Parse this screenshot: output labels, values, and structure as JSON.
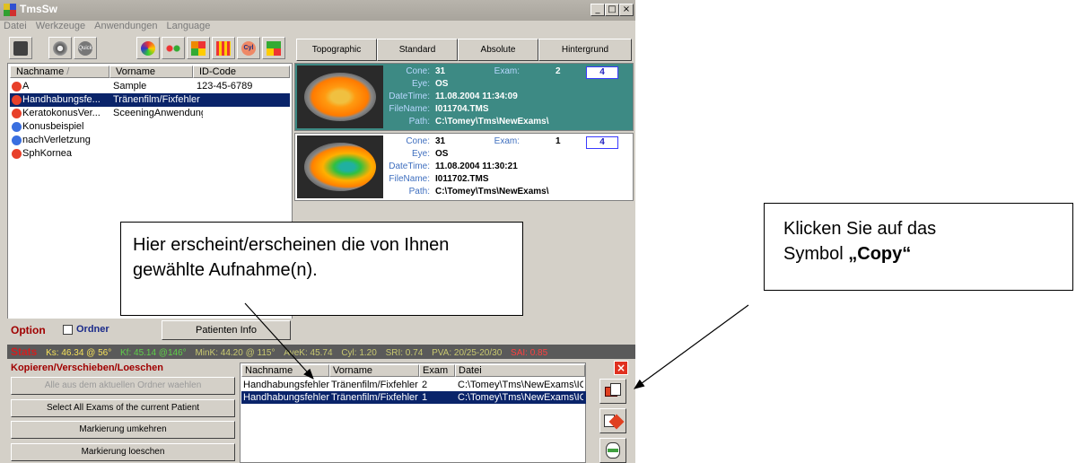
{
  "window": {
    "title": "TmsSw",
    "controls": [
      "_",
      "□",
      "×"
    ]
  },
  "menu": [
    "Datei",
    "Werkzeuge",
    "Anwendungen",
    "Language"
  ],
  "toolbar": {
    "icons": [
      "film-icon",
      "disc-icon",
      "quick-icon",
      "color-wheel-icon",
      "dots-icon",
      "grid-icon",
      "matrix-icon",
      "cyl-icon",
      "compare-icon"
    ],
    "quick_label": "Quick",
    "cyl_label": "Cyl"
  },
  "tabs": [
    "Topographic",
    "Standard",
    "Absolute",
    "Hintergrund"
  ],
  "patient_list": {
    "headers": [
      "Nachname",
      "Vorname",
      "ID-Code"
    ],
    "rows": [
      {
        "lastname": "A",
        "firstname": "Sample",
        "id": "123-45-6789",
        "icon_color": "#e8402a"
      },
      {
        "lastname": "Handhabungsfe...",
        "firstname": "Tränenfilm/Fixfehler",
        "id": "",
        "icon_color": "#e8402a",
        "selected": true
      },
      {
        "lastname": "KeratokonusVer...",
        "firstname": "SceeningAnwendung!",
        "id": "",
        "icon_color": "#e8402a"
      },
      {
        "lastname": "Konusbeispiel",
        "firstname": "",
        "id": "",
        "icon_color": "#3a6fe0"
      },
      {
        "lastname": "nachVerletzung",
        "firstname": "",
        "id": "",
        "icon_color": "#3a6fe0"
      },
      {
        "lastname": "SphKornea",
        "firstname": "",
        "id": "",
        "icon_color": "#e8402a"
      }
    ]
  },
  "exam_cards": [
    {
      "cone_label": "Cone:",
      "cone": "31",
      "exam_label": "Exam:",
      "exam": "2",
      "eye_label": "Eye:",
      "eye": "OS",
      "datetime_label": "DateTime:",
      "datetime": "11.08.2004 11:34:09",
      "filename_label": "FileName:",
      "filename": "I011704.TMS",
      "path_label": "Path:",
      "path": "C:\\Tomey\\Tms\\NewExams\\",
      "number": "4",
      "selected": true
    },
    {
      "cone_label": "Cone:",
      "cone": "31",
      "exam_label": "Exam:",
      "exam": "1",
      "eye_label": "Eye:",
      "eye": "OS",
      "datetime_label": "DateTime:",
      "datetime": "11.08.2004 11:30:21",
      "filename_label": "FileName:",
      "filename": "I011702.TMS",
      "path_label": "Path:",
      "path": "C:\\Tomey\\Tms\\NewExams\\",
      "number": "4",
      "selected": false
    }
  ],
  "option": {
    "label": "Option",
    "ordner_label": "Ordner",
    "patienten_info": "Patienten Info"
  },
  "stats": {
    "label": "Stats",
    "items": [
      {
        "text": "Ks: 46.34 @ 56°",
        "color": "#f5e05a"
      },
      {
        "text": "Kf: 45.14 @146°",
        "color": "#5fcf4a"
      },
      {
        "text": "MinK: 44.20 @ 115°",
        "color": "#c8c870"
      },
      {
        "text": "AveK: 45.74",
        "color": "#c8c870"
      },
      {
        "text": "Cyl: 1.20",
        "color": "#c8c870"
      },
      {
        "text": "SRI: 0.74",
        "color": "#c8c870"
      },
      {
        "text": "PVA: 20/25-20/30",
        "color": "#c8c870"
      },
      {
        "text": "SAI: 0.85",
        "color": "#ff4040"
      }
    ]
  },
  "copy_panel": {
    "title": "Kopieren/Verschieben/Loeschen",
    "buttons": [
      {
        "label": "Alle aus dem aktuellen Ordner waehlen",
        "disabled": true
      },
      {
        "label": "Select All Exams of the current Patient",
        "disabled": false
      },
      {
        "label": "Markierung umkehren",
        "disabled": false
      },
      {
        "label": "Markierung loeschen",
        "disabled": false
      }
    ]
  },
  "exam_list": {
    "headers": [
      "Nachname",
      "Vorname",
      "Exam",
      "Datei"
    ],
    "rows": [
      {
        "nachname": "Handhabungsfehler",
        "vorname": "Tränenfilm/Fixfehler",
        "exam": "2",
        "datei": "C:\\Tomey\\Tms\\NewExams\\IC",
        "selected": false
      },
      {
        "nachname": "Handhabungsfehler",
        "vorname": "Tränenfilm/Fixfehler",
        "exam": "1",
        "datei": "C:\\Tomey\\Tms\\NewExams\\IC",
        "selected": true
      }
    ]
  },
  "side_buttons": [
    "close-icon",
    "copy-icon",
    "move-icon",
    "delete-icon"
  ],
  "callouts": {
    "left": [
      "Hier erscheint/erscheinen die von Ihnen",
      "gewählte Aufnahme(n)."
    ],
    "right_line1": "Klicken Sie auf das",
    "right_prefix": "Symbol ",
    "right_bold": "„Copy“"
  }
}
